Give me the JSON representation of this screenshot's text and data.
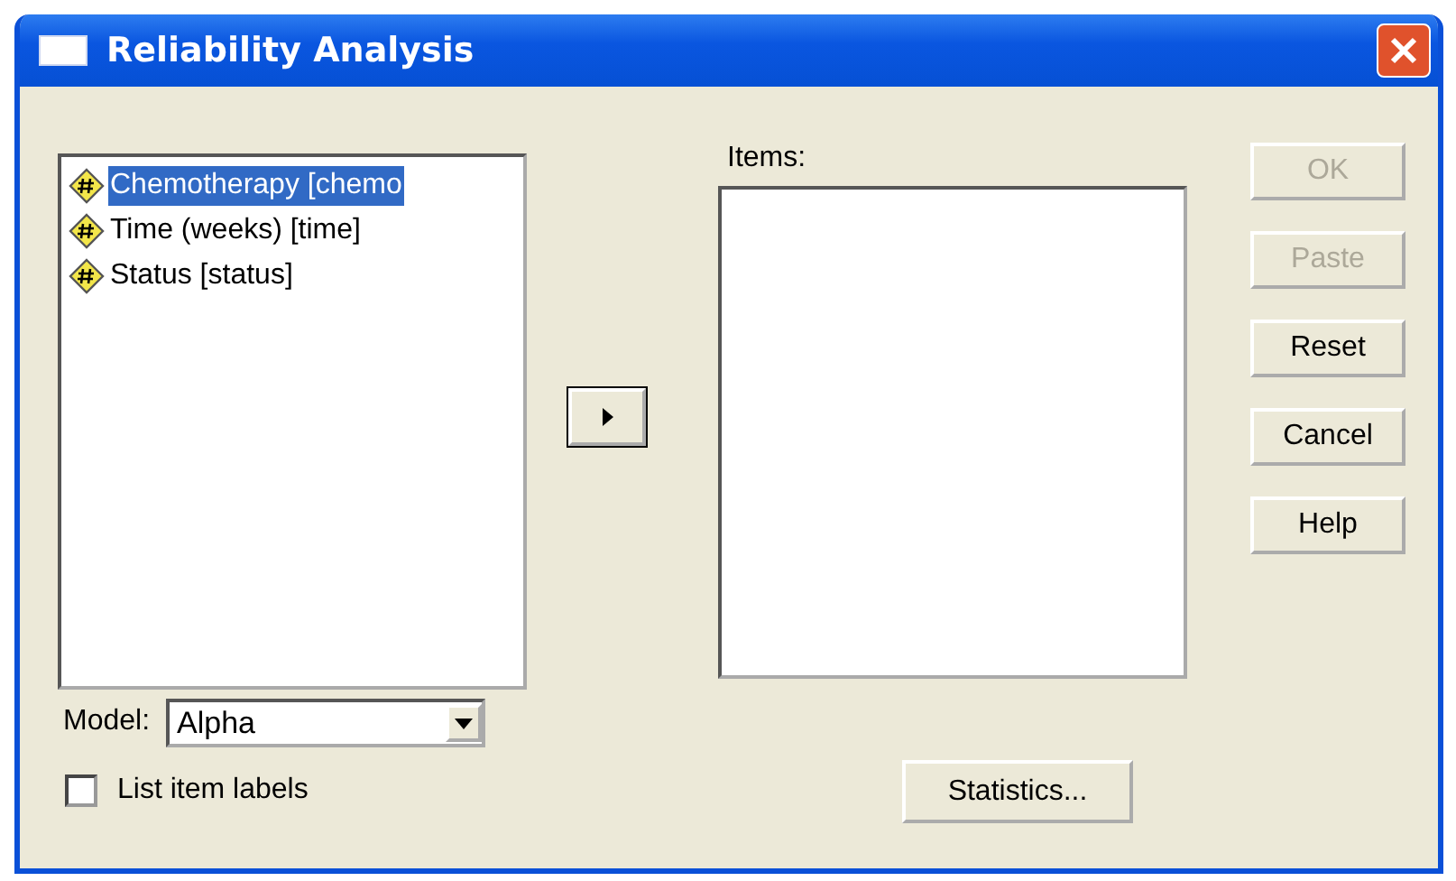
{
  "window": {
    "title": "Reliability Analysis"
  },
  "variables": [
    {
      "label": "Chemotherapy [chemo",
      "selected": true
    },
    {
      "label": "Time (weeks) [time]",
      "selected": false
    },
    {
      "label": "Status [status]",
      "selected": false
    }
  ],
  "items": {
    "label": "Items:"
  },
  "buttons": [
    {
      "label": "OK",
      "disabled": true
    },
    {
      "label": "Paste",
      "disabled": true
    },
    {
      "label": "Reset",
      "disabled": false
    },
    {
      "label": "Cancel",
      "disabled": false
    },
    {
      "label": "Help",
      "disabled": false
    }
  ],
  "model": {
    "label": "Model:",
    "value": "Alpha"
  },
  "list_item_labels": {
    "label": "List item labels",
    "checked": false
  },
  "statistics_button": {
    "label": "Statistics..."
  }
}
